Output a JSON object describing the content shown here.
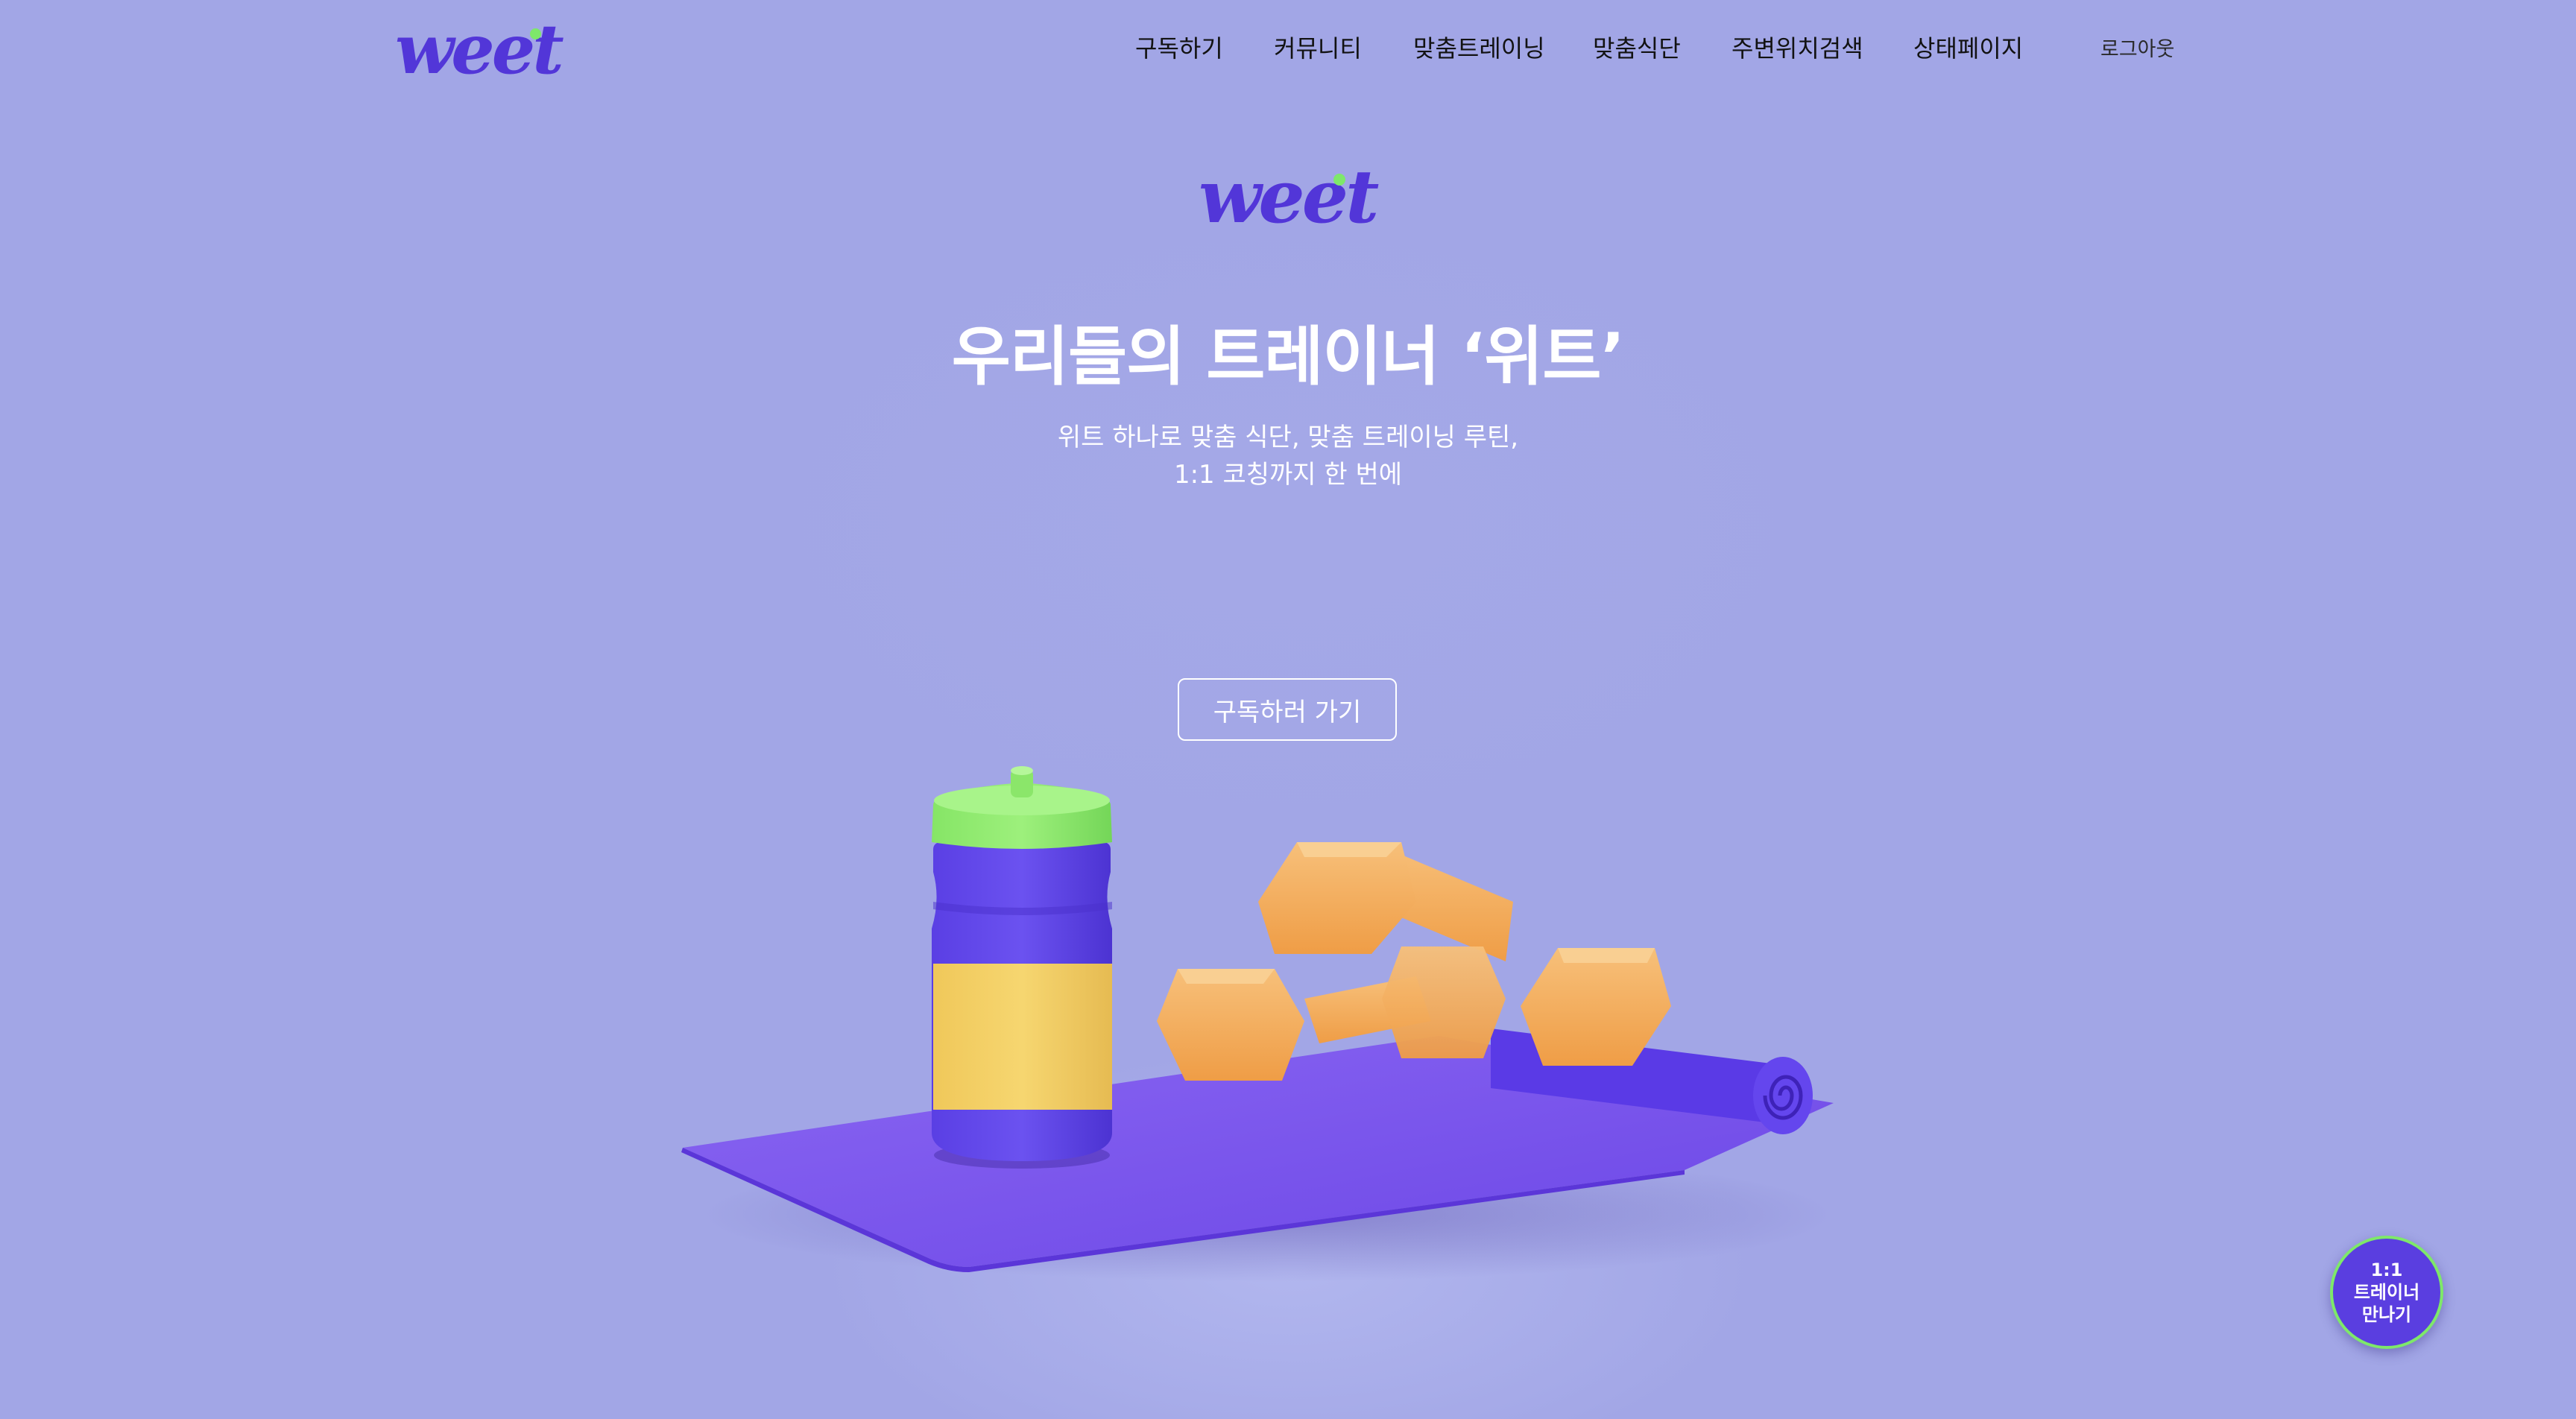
{
  "header": {
    "logo_text": "weet",
    "nav": [
      {
        "label": "구독하기"
      },
      {
        "label": "커뮤니티"
      },
      {
        "label": "맞춤트레이닝"
      },
      {
        "label": "맞춤식단"
      },
      {
        "label": "주변위치검색"
      },
      {
        "label": "상태페이지"
      }
    ],
    "logout_label": "로그아웃"
  },
  "hero": {
    "logo_text": "weet",
    "title": "우리들의 트레이너 ‘위트’",
    "subtitle_line1": "위트 하나로 맞춤 식단, 맞춤 트레이닝 루틴,",
    "subtitle_line2": "1:1 코칭까지 한 번에",
    "cta_label": "구독하러 가기"
  },
  "floating": {
    "trainer_label": "1:1\n트레이너\n만나기"
  },
  "colors": {
    "background": "#a2a6e6",
    "brand": "#5236d8",
    "accent": "#7ee86a",
    "dumbbell": "#f5b15c",
    "bottle_label": "#f3cd62",
    "mat": "#7b56ee"
  }
}
